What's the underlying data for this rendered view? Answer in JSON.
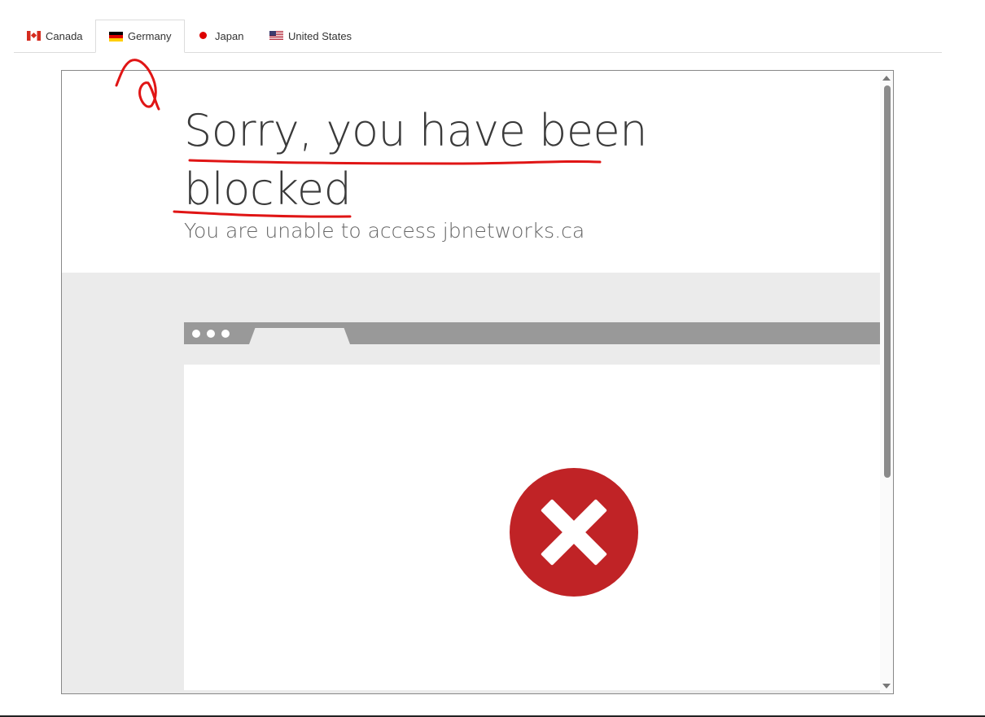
{
  "tabs": [
    {
      "label": "Canada",
      "flag": "canada-flag-icon",
      "active": false
    },
    {
      "label": "Germany",
      "flag": "germany-flag-icon",
      "active": true
    },
    {
      "label": "Japan",
      "flag": "japan-flag-icon",
      "active": false
    },
    {
      "label": "United States",
      "flag": "us-flag-icon",
      "active": false
    }
  ],
  "blocked_page": {
    "title": "Sorry, you have been blocked",
    "subtitle": "You are unable to access jbnetworks.ca",
    "icon": "error-x-icon"
  },
  "colors": {
    "error_red": "#c02326",
    "annotation_red": "#e01515",
    "browser_chrome": "#999999",
    "page_gray": "#ebebeb"
  }
}
